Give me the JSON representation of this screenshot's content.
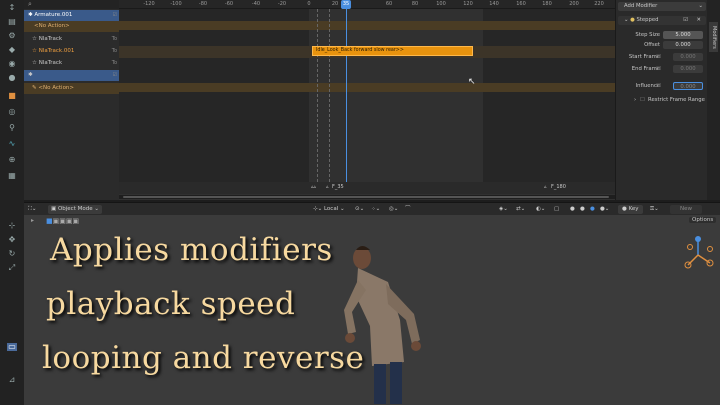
{
  "tracks": [
    {
      "label": "Armature.001",
      "tag": ""
    },
    {
      "label": "<No Action>",
      "tag": ""
    },
    {
      "label": "NlaTrack",
      "tag": "To"
    },
    {
      "label": "NlaTrack.001",
      "tag": "To"
    },
    {
      "label": "NlaTrack",
      "tag": "To"
    },
    {
      "label": "",
      "tag": ""
    },
    {
      "label": "<No Action>",
      "tag": ""
    }
  ],
  "ruler_ticks": [
    "-120",
    "-100",
    "-80",
    "-60",
    "-40",
    "-20",
    "0",
    "20",
    "40",
    "60",
    "80",
    "100",
    "120",
    "140",
    "160",
    "180",
    "200",
    "220"
  ],
  "playhead_frame": "35",
  "strip_label": "Idle_Look_Back forward slow rear>>",
  "markers": [
    {
      "label": "F_35"
    },
    {
      "label": "F_180"
    }
  ],
  "modifier_panel": {
    "add_label": "Add Modifier",
    "modifier_name": "Stepped",
    "fields": [
      {
        "label": "Step Size",
        "value": "5.000"
      },
      {
        "label": "Offset",
        "value": "0.000"
      },
      {
        "label": "Start Frame",
        "value": "0.000"
      },
      {
        "label": "End Frame",
        "value": "0.000"
      }
    ],
    "influence_label": "Influence",
    "influence_value": "0.000",
    "restrict_label": "Restrict Frame Range"
  },
  "right_tabs": [
    "Modifiers"
  ],
  "viewport_header": {
    "mode": "Object Mode",
    "orientation": "Local",
    "keying": "Key",
    "keying_set": "New",
    "options": "Options"
  },
  "caption": {
    "line1": "Applies modifiers",
    "line2": "playback speed",
    "line3": "looping and reverse"
  },
  "colors": {
    "strip": "#e8930e",
    "playhead": "#4a8fe0",
    "selected_track": "#3a5a8a"
  }
}
